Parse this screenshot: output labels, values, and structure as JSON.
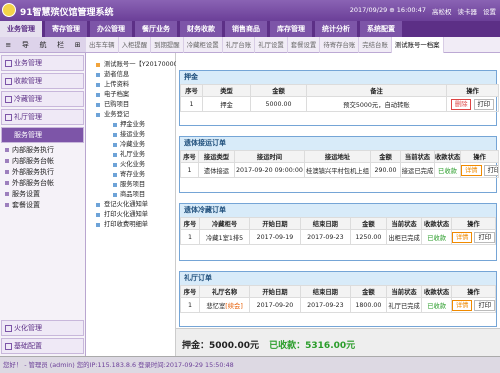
{
  "app": {
    "title": "91智慧殡仪馆管理系统",
    "date_time": "2017/09/29 ⊕ 16:00:47",
    "user": "高松权",
    "switch": "读卡器",
    "settings": "设置"
  },
  "nav": [
    "业务管理",
    "寄存管理",
    "办公管理",
    "餐厅业务",
    "财务收款",
    "销售商品",
    "库存管理",
    "统计分析",
    "系统配置"
  ],
  "toolbar": {
    "icons": [
      "list-icon",
      "navigation-icon",
      "column-icon",
      "thumbnail-icon",
      "tools-icon"
    ],
    "labels": [
      "≡",
      "导",
      "航",
      "栏",
      "⊞"
    ]
  },
  "tabs": [
    "出车车辆",
    "入柜提醒",
    "到期提醒",
    "冷藏柜设置",
    "礼厅台账",
    "礼厅设置",
    "套餐设置",
    "待寄存台账",
    "完结台账",
    "测试账号一档案"
  ],
  "sidebar": {
    "menus": [
      "业务管理",
      "收款管理",
      "冷藏管理",
      "礼厅管理",
      "服务管理"
    ],
    "submenus": [
      "内部服务执行",
      "内部服务台帐",
      "外部服务执行",
      "外部服务台帐",
      "服务设置",
      "套餐设置"
    ],
    "bottom": [
      "火化管理",
      "基础配置"
    ]
  },
  "tree": [
    {
      "label": "测试账号一【Y20170000",
      "level": 0
    },
    {
      "label": "逝者信息",
      "level": 1
    },
    {
      "label": "上传资料",
      "level": 1
    },
    {
      "label": "电子档案",
      "level": 1
    },
    {
      "label": "已购项目",
      "level": 1
    },
    {
      "label": "业务登记",
      "level": 1
    },
    {
      "label": "押金业务",
      "level": 2
    },
    {
      "label": "接运业务",
      "level": 2
    },
    {
      "label": "冷藏业务",
      "level": 2
    },
    {
      "label": "礼厅业务",
      "level": 2
    },
    {
      "label": "火化业务",
      "level": 2
    },
    {
      "label": "寄存业务",
      "level": 2
    },
    {
      "label": "服务项目",
      "level": 2
    },
    {
      "label": "商品项目",
      "level": 2
    },
    {
      "label": "登记火化通知单",
      "level": 1
    },
    {
      "label": "打印火化通知单",
      "level": 1
    },
    {
      "label": "打印收费明细单",
      "level": 1
    }
  ],
  "panels": [
    {
      "title": "押金",
      "headers": [
        "序号",
        "类型",
        "金额",
        "备注",
        "操作"
      ],
      "rows": [
        [
          "1",
          "押金",
          "5000.00",
          "预交5000元，自动转账"
        ]
      ],
      "buttons": [
        "删除",
        "打印"
      ]
    },
    {
      "title": "遗体接运订单",
      "headers": [
        "序号",
        "接运类型",
        "接运时间",
        "接运地址",
        "金额",
        "当前状态",
        "收款状态",
        "操作"
      ],
      "rows": [
        [
          "1",
          "遗体接运",
          "2017-09-20 09:00:00",
          "桂澳镇兴平村包机上组",
          "290.00",
          "接运已完成",
          "已收款"
        ]
      ],
      "buttons": [
        "详情",
        "打印"
      ]
    },
    {
      "title": "遗体冷藏订单",
      "headers": [
        "序号",
        "冷藏柜号",
        "开始日期",
        "结束日期",
        "金额",
        "当前状态",
        "收款状态",
        "操作"
      ],
      "rows": [
        [
          "1",
          "冷藏1室1排5",
          "2017-09-19",
          "2017-09-23",
          "1250.00",
          "出柜已完成",
          "已收款"
        ]
      ],
      "buttons": [
        "详情",
        "打印"
      ]
    },
    {
      "title": "礼厅订单",
      "headers": [
        "序号",
        "礼厅名称",
        "开始日期",
        "结束日期",
        "金额",
        "当前状态",
        "收款状态",
        "操作"
      ],
      "rows": [
        [
          "1",
          "悲忆室",
          "2017-09-20",
          "2017-09-23",
          "1800.00",
          "礼厅已完成",
          "已收款"
        ]
      ],
      "tag": "[续会]",
      "buttons": [
        "详情",
        "打印"
      ]
    }
  ],
  "summary": {
    "deposit": "押金：5000.00元",
    "received": "已收款：5316.00元"
  },
  "status": {
    "text": "您好！ - 管理员 (admin)  您的IP:115.183.8.6  登录时间:2017-09-29 15:50:48"
  }
}
